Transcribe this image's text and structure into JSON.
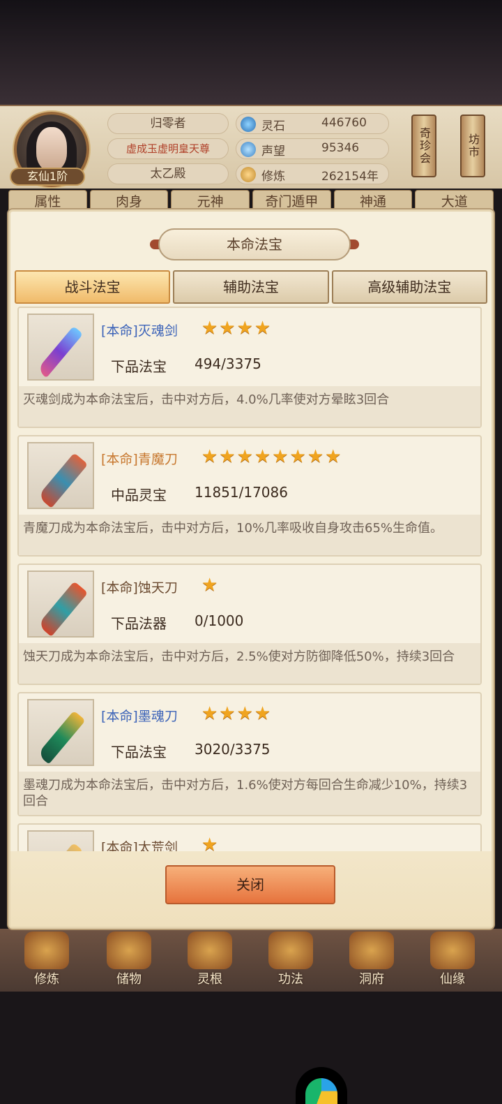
{
  "header": {
    "rank": "玄仙1阶",
    "player_name": "归零者",
    "title": "虚成玉虚明皇天尊",
    "sect": "太乙殿",
    "resources": [
      {
        "label": "灵石",
        "value": "446760"
      },
      {
        "label": "声望",
        "value": "95346"
      },
      {
        "label": "修炼",
        "value": "262154年"
      }
    ],
    "side_buttons": [
      "奇珍会",
      "坊市"
    ]
  },
  "back_tabs": [
    "属性",
    "肉身",
    "元神",
    "奇门遁甲",
    "神通",
    "大道"
  ],
  "modal": {
    "title": "本命法宝",
    "tabs": [
      "战斗法宝",
      "辅助法宝",
      "高级辅助法宝"
    ],
    "items": [
      {
        "name": "[本命]灭魂剑",
        "stars": "★★★★",
        "grade": "下品法宝",
        "progress": "494/3375",
        "desc": "灭魂剑成为本命法宝后，击中对方后，4.0%几率使对方晕眩3回合"
      },
      {
        "name": "[本命]青魔刀",
        "stars": "★★★★★★★★",
        "grade": "中品灵宝",
        "progress": "11851/17086",
        "desc": "青魔刀成为本命法宝后，击中对方后，10%几率吸收自身攻击65%生命值。"
      },
      {
        "name": "[本命]蚀天刀",
        "stars": "★",
        "grade": "下品法器",
        "progress": "0/1000",
        "desc": "蚀天刀成为本命法宝后，击中对方后，2.5%使对方防御降低50%，持续3回合"
      },
      {
        "name": "[本命]墨魂刀",
        "stars": "★★★★",
        "grade": "下品法宝",
        "progress": "3020/3375",
        "desc": "墨魂刀成为本命法宝后，击中对方后，1.6%使对方每回合生命减少10%，持续3回合"
      },
      {
        "name": "[本命]太荒剑",
        "stars": "★",
        "grade": "",
        "progress": "",
        "desc": ""
      }
    ],
    "close_label": "关闭"
  },
  "bottom_nav": [
    "修炼",
    "储物",
    "灵根",
    "功法",
    "洞府",
    "仙缘"
  ]
}
